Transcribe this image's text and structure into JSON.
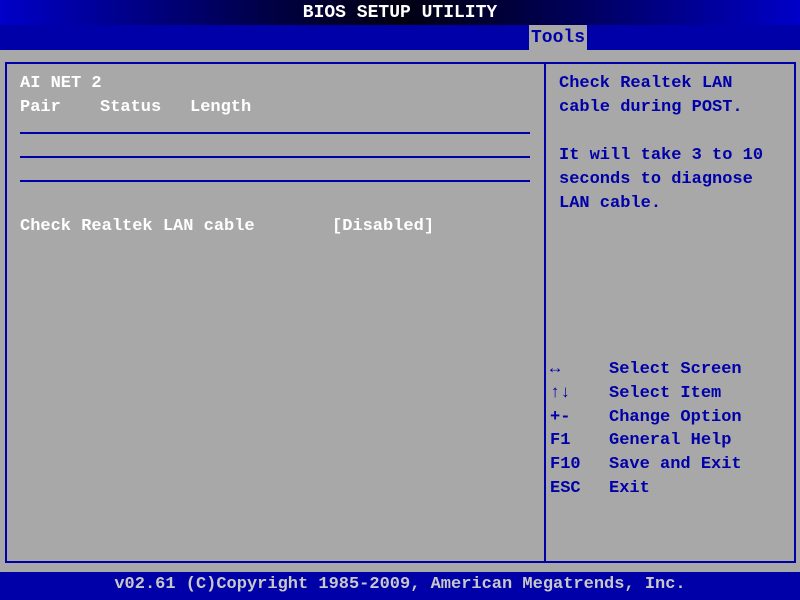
{
  "title": "BIOS SETUP UTILITY",
  "tabs": [
    {
      "label": "Tools",
      "active": true
    }
  ],
  "main": {
    "section_title": "AI NET 2",
    "columns": [
      "Pair",
      "Status",
      "Length"
    ],
    "setting": {
      "label": "Check Realtek LAN cable",
      "value": "[Disabled]"
    }
  },
  "help": {
    "lines": [
      "Check Realtek LAN",
      "cable during POST.",
      "",
      "It will take 3 to 10",
      "seconds to diagnose",
      "LAN cable."
    ]
  },
  "keys": [
    {
      "key": "↔",
      "action": "Select Screen"
    },
    {
      "key": "↑↓",
      "action": "Select Item"
    },
    {
      "key": "+-",
      "action": "Change Option"
    },
    {
      "key": "F1",
      "action": "General Help"
    },
    {
      "key": "F10",
      "action": "Save and Exit"
    },
    {
      "key": "ESC",
      "action": "Exit"
    }
  ],
  "footer": "v02.61 (C)Copyright 1985-2009, American Megatrends, Inc.",
  "colors": {
    "blue": "#0000a8",
    "gray": "#a8a8a8"
  }
}
